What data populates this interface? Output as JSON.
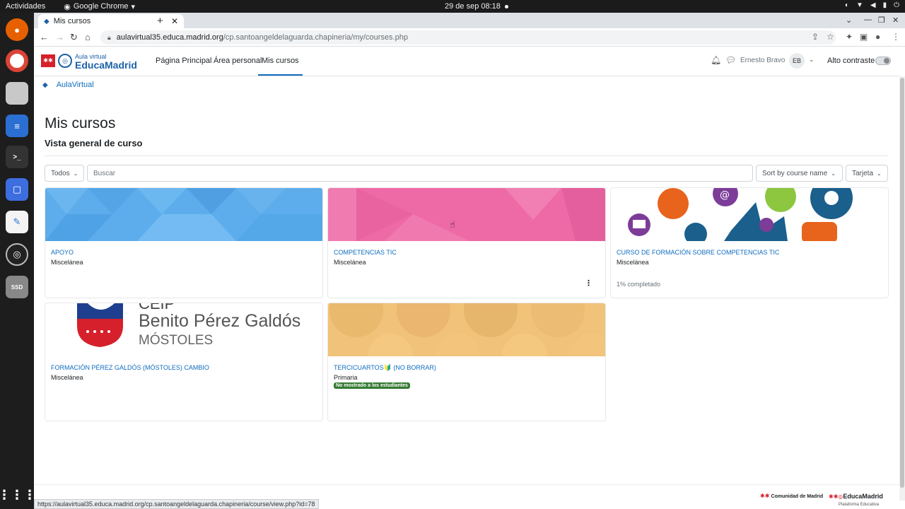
{
  "os": {
    "activities": "Actividades",
    "app_name": "Google Chrome",
    "clock": "29 de sep  08:18"
  },
  "browser": {
    "tab_title": "Mis cursos",
    "url_host": "aulavirtual35.educa.madrid.org",
    "url_path": "/cp.santoangeldelaguarda.chapineria/my/courses.php",
    "status_url": "https://aulavirtual35.educa.madrid.org/cp.santoangeldelaguarda.chapineria/course/view.php?id=78"
  },
  "header": {
    "logo_small": "Aula virtual",
    "logo_big": "EducaMadrid",
    "nav": [
      "Página Principal",
      "Área personal",
      "Mis cursos"
    ],
    "user_name": "Ernesto Bravo",
    "user_initials": "EB",
    "contrast_label": "Alto contraste"
  },
  "breadcrumb": "AulaVirtual",
  "page": {
    "title": "Mis cursos",
    "section": "Vista general de curso"
  },
  "controls": {
    "filter": "Todos",
    "search_placeholder": "Buscar",
    "sort": "Sort by course name",
    "view": "Tarjeta"
  },
  "courses": [
    {
      "name": "APOYO",
      "category": "Miscelánea",
      "progress": ""
    },
    {
      "name": "COMPETENCIAS TIC",
      "category": "Miscelánea",
      "progress": ""
    },
    {
      "name": "CURSO DE FORMACIÓN SOBRE COMPETENCIAS TIC",
      "category": "Miscelánea",
      "progress": "1% completado"
    },
    {
      "name": "FORMACIÓN PÉREZ GALDÓS (MÓSTOLES) CAMBIO",
      "category": "Miscelánea",
      "progress": "",
      "image_text_main": "Benito Pérez Galdós",
      "image_text_sub": "MÓSTOLES",
      "image_text_top": "CEIP"
    },
    {
      "name": "TERCICUARTOS🔰 (NO BORRAR)",
      "category": "Primaria",
      "badge": "No mostrado a los estudiantes"
    }
  ],
  "footer": {
    "logo_left": "Comunidad de Madrid",
    "logo_right": "EducaMadrid",
    "logo_right_sub": "Plataforma Educativa"
  }
}
